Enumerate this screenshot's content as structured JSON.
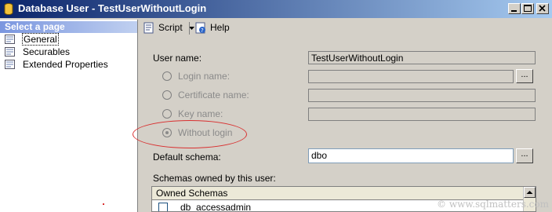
{
  "window": {
    "title": "Database User - TestUserWithoutLogin",
    "controls": [
      "minimize-icon",
      "maximize-icon",
      "close-icon"
    ]
  },
  "sidebar": {
    "header": "Select a page",
    "items": [
      {
        "label": "General",
        "icon": "page-icon",
        "selected": true
      },
      {
        "label": "Securables",
        "icon": "page-icon",
        "selected": false
      },
      {
        "label": "Extended Properties",
        "icon": "page-icon",
        "selected": false
      }
    ]
  },
  "toolbar": {
    "script_label": "Script",
    "help_label": "Help"
  },
  "form": {
    "user_name_label": "User name:",
    "user_name_value": "TestUserWithoutLogin",
    "login_name_label": "Login name:",
    "certificate_name_label": "Certificate name:",
    "key_name_label": "Key name:",
    "without_login_label": "Without login",
    "default_schema_label": "Default schema:",
    "default_schema_value": "dbo",
    "browse_label": "...",
    "schemas_owned_label": "Schemas owned by this user:"
  },
  "schemas_grid": {
    "header": "Owned Schemas",
    "rows": [
      {
        "name": "db_accessadmin",
        "checked": false
      }
    ]
  },
  "watermark": "© www.sqlmatters.com"
}
